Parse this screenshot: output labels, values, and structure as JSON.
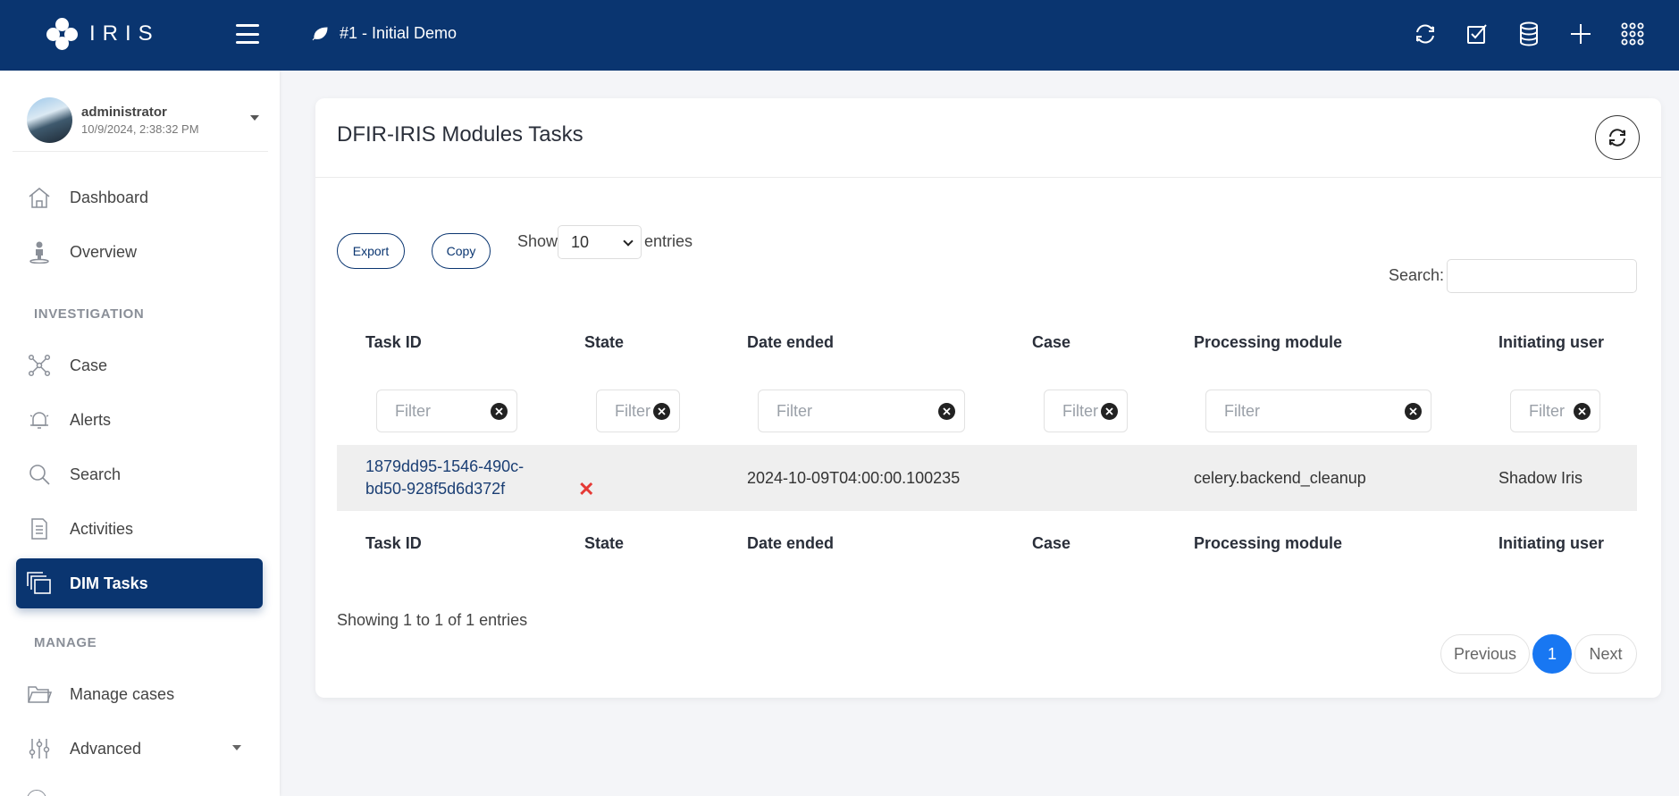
{
  "header": {
    "logo_text": "IRIS",
    "case_title": "#1 - Initial Demo",
    "icons": [
      "sync-icon",
      "checkbox-icon",
      "database-icon",
      "plus-icon",
      "grid-icon"
    ],
    "color": "#0a3570"
  },
  "user": {
    "name": "administrator",
    "timestamp": "10/9/2024, 2:38:32 PM"
  },
  "sidebar": {
    "items": [
      {
        "label": "Dashboard",
        "icon": "home-icon"
      },
      {
        "label": "Overview",
        "icon": "person-pin-icon"
      },
      {
        "label": "Case",
        "icon": "network-icon"
      },
      {
        "label": "Alerts",
        "icon": "bell-icon"
      },
      {
        "label": "Search",
        "icon": "search-icon"
      },
      {
        "label": "Activities",
        "icon": "document-icon"
      },
      {
        "label": "DIM Tasks",
        "icon": "stack-icon",
        "active": true
      },
      {
        "label": "Manage cases",
        "icon": "folder-icon"
      },
      {
        "label": "Advanced",
        "icon": "sliders-icon"
      }
    ],
    "sections": [
      "INVESTIGATION",
      "MANAGE"
    ]
  },
  "page": {
    "title": "DFIR-IRIS Modules Tasks",
    "export_label": "Export",
    "copy_label": "Copy",
    "show_label": "Show",
    "entries_label": "entries",
    "page_size": "10",
    "search_label": "Search:",
    "search_value": ""
  },
  "table": {
    "columns": [
      "Task ID",
      "State",
      "Date ended",
      "Case",
      "Processing module",
      "Initiating user"
    ],
    "filter_placeholder": "Filter",
    "rows": [
      {
        "task_id_line1": "1879dd95-1546-490c-",
        "task_id_line2": "bd50-928f5d6d372f",
        "state": "✕",
        "date_ended": "2024-10-09T04:00:00.100235",
        "case": "",
        "processing_module": "celery.backend_cleanup",
        "initiating_user": "Shadow Iris"
      }
    ]
  },
  "footer": {
    "info": "Showing 1 to 1 of 1 entries",
    "previous": "Previous",
    "current_page": "1",
    "next": "Next"
  }
}
